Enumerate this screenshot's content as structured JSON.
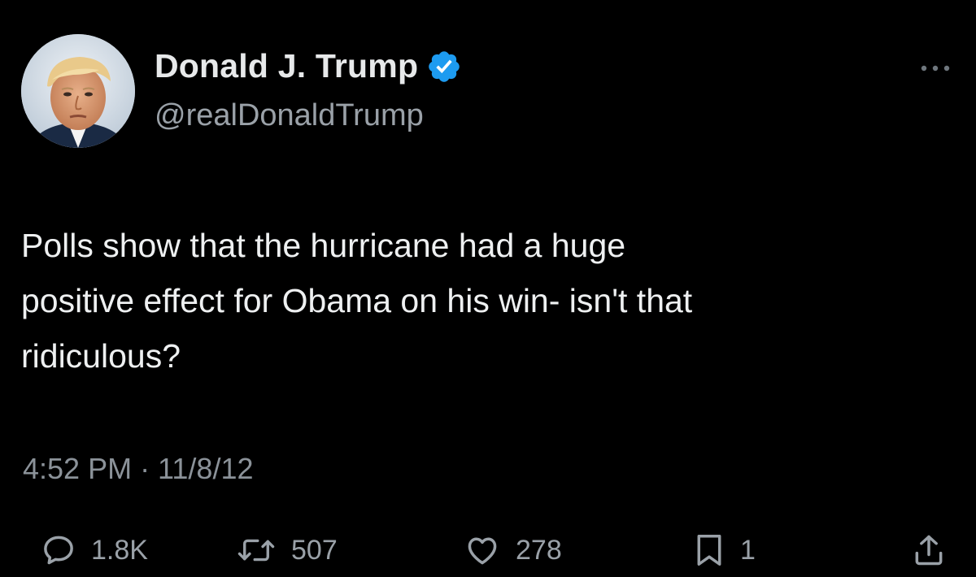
{
  "tweet": {
    "author": {
      "display_name": "Donald J. Trump",
      "handle": "@realDonaldTrump",
      "verified": true,
      "avatar_icon": "profile-photo",
      "verified_color": "#1d9bf0"
    },
    "text_lines": [
      "Polls show that the hurricane had a huge",
      "positive effect for Obama on his win- isn't that",
      "ridiculous?"
    ],
    "timestamp": "4:52 PM · 11/8/12",
    "actions": {
      "replies": "1.8K",
      "retweets": "507",
      "likes": "278",
      "bookmarks": "1"
    },
    "icons": {
      "more": "more-horizontal-icon",
      "reply": "reply-icon",
      "retweet": "retweet-icon",
      "like": "heart-icon",
      "bookmark": "bookmark-icon",
      "share": "share-icon"
    },
    "theme": {
      "background": "#000000",
      "text": "#e7e9ea",
      "secondary": "#9aa1a8"
    }
  }
}
